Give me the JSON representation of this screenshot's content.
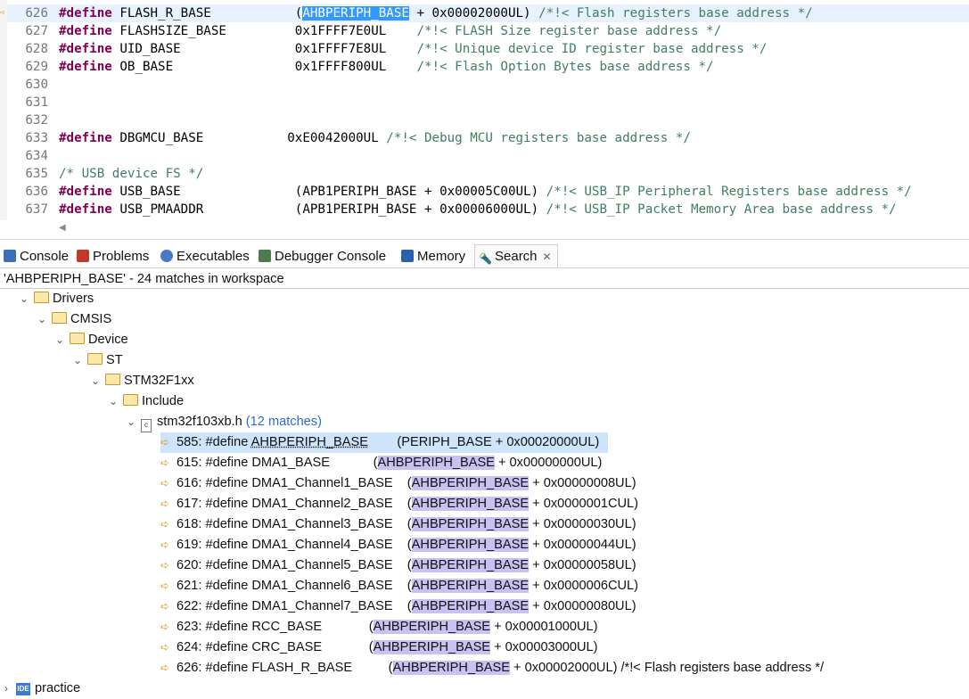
{
  "editor": {
    "lines": [
      {
        "num": "626",
        "current": true,
        "parts": [
          {
            "t": "#define",
            "c": "kw"
          },
          {
            "t": " FLASH_R_BASE           ("
          },
          {
            "t": "AHBPERIPH_BASE",
            "c": "hl"
          },
          {
            "t": " + 0x00002000UL) "
          },
          {
            "t": "/*!< Flash registers base address */",
            "c": "cm"
          }
        ]
      },
      {
        "num": "627",
        "parts": [
          {
            "t": "#define",
            "c": "kw"
          },
          {
            "t": " FLASHSIZE_BASE         0x1FFFF7E0UL    "
          },
          {
            "t": "/*!< FLASH Size register base address */",
            "c": "cm"
          }
        ]
      },
      {
        "num": "628",
        "parts": [
          {
            "t": "#define",
            "c": "kw"
          },
          {
            "t": " UID_BASE               0x1FFFF7E8UL    "
          },
          {
            "t": "/*!< Unique device ID register base address */",
            "c": "cm"
          }
        ]
      },
      {
        "num": "629",
        "parts": [
          {
            "t": "#define",
            "c": "kw"
          },
          {
            "t": " OB_BASE                0x1FFFF800UL    "
          },
          {
            "t": "/*!< Flash Option Bytes base address */",
            "c": "cm"
          }
        ]
      },
      {
        "num": "630",
        "parts": []
      },
      {
        "num": "631",
        "parts": []
      },
      {
        "num": "632",
        "parts": []
      },
      {
        "num": "633",
        "parts": [
          {
            "t": "#define",
            "c": "kw"
          },
          {
            "t": " DBGMCU_BASE           0xE0042000UL "
          },
          {
            "t": "/*!< Debug MCU registers base address */",
            "c": "cm"
          }
        ]
      },
      {
        "num": "634",
        "parts": []
      },
      {
        "num": "635",
        "parts": [
          {
            "t": "/* USB device FS */",
            "c": "cm"
          }
        ]
      },
      {
        "num": "636",
        "parts": [
          {
            "t": "#define",
            "c": "kw"
          },
          {
            "t": " USB_BASE               (APB1PERIPH_BASE + 0x00005C00UL) "
          },
          {
            "t": "/*!< USB_IP Peripheral Registers base address */",
            "c": "cm"
          }
        ]
      },
      {
        "num": "637",
        "parts": [
          {
            "t": "#define",
            "c": "kw"
          },
          {
            "t": " USB_PMAADDR            (APB1PERIPH_BASE + 0x00006000UL) "
          },
          {
            "t": "/*!< USB_IP Packet Memory Area base address */",
            "c": "cm"
          }
        ]
      }
    ]
  },
  "tabs": [
    {
      "label": "Console",
      "icon": "console-icon",
      "color": "#3c6fb5"
    },
    {
      "label": "Problems",
      "icon": "problems-icon",
      "color": "#c0392b"
    },
    {
      "label": "Executables",
      "icon": "executables-icon",
      "color": "#4a78c8"
    },
    {
      "label": "Debugger Console",
      "icon": "debugger-console-icon",
      "color": "#4d7b4d"
    },
    {
      "label": "Memory",
      "icon": "memory-icon",
      "color": "#2d5fb0"
    },
    {
      "label": "Search",
      "icon": "search-flashlight-icon",
      "color": "#d9a030",
      "active": true
    }
  ],
  "search": {
    "summary": "'AHBPERIPH_BASE' - 24 matches in workspace",
    "tree": [
      {
        "label": "Drivers",
        "type": "folder",
        "depth": 0
      },
      {
        "label": "CMSIS",
        "type": "folder",
        "depth": 1
      },
      {
        "label": "Device",
        "type": "folder",
        "depth": 2
      },
      {
        "label": "ST",
        "type": "folder",
        "depth": 3
      },
      {
        "label": "STM32F1xx",
        "type": "folder",
        "depth": 4
      },
      {
        "label": "Include",
        "type": "folder",
        "depth": 5
      },
      {
        "label": "stm32f103xb.h",
        "type": "file",
        "depth": 6,
        "matches": "(12 matches)"
      }
    ],
    "matches": [
      {
        "prefix": "585: #define ",
        "hit": "AHBPERIPH_BASE",
        "suffix": "        (PERIPH_BASE + 0x00020000UL)",
        "selected": true
      },
      {
        "prefix": "615: #define DMA1_BASE            (",
        "hit": "AHBPERIPH_BASE",
        "suffix": " + 0x00000000UL)"
      },
      {
        "prefix": "616: #define DMA1_Channel1_BASE    (",
        "hit": "AHBPERIPH_BASE",
        "suffix": " + 0x00000008UL)"
      },
      {
        "prefix": "617: #define DMA1_Channel2_BASE    (",
        "hit": "AHBPERIPH_BASE",
        "suffix": " + 0x0000001CUL)"
      },
      {
        "prefix": "618: #define DMA1_Channel3_BASE    (",
        "hit": "AHBPERIPH_BASE",
        "suffix": " + 0x00000030UL)"
      },
      {
        "prefix": "619: #define DMA1_Channel4_BASE    (",
        "hit": "AHBPERIPH_BASE",
        "suffix": " + 0x00000044UL)"
      },
      {
        "prefix": "620: #define DMA1_Channel5_BASE    (",
        "hit": "AHBPERIPH_BASE",
        "suffix": " + 0x00000058UL)"
      },
      {
        "prefix": "621: #define DMA1_Channel6_BASE    (",
        "hit": "AHBPERIPH_BASE",
        "suffix": " + 0x0000006CUL)"
      },
      {
        "prefix": "622: #define DMA1_Channel7_BASE    (",
        "hit": "AHBPERIPH_BASE",
        "suffix": " + 0x00000080UL)"
      },
      {
        "prefix": "623: #define RCC_BASE             (",
        "hit": "AHBPERIPH_BASE",
        "suffix": " + 0x00001000UL)"
      },
      {
        "prefix": "624: #define CRC_BASE             (",
        "hit": "AHBPERIPH_BASE",
        "suffix": " + 0x00003000UL)"
      },
      {
        "prefix": "626: #define FLASH_R_BASE          (",
        "hit": "AHBPERIPH_BASE",
        "suffix": " + 0x00002000UL) /*!< Flash registers base address */"
      }
    ],
    "project": {
      "label": "practice",
      "badge": "IDE"
    }
  }
}
